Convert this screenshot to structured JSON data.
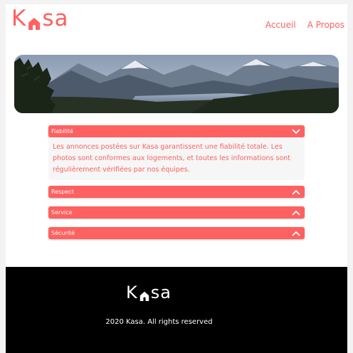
{
  "header": {
    "logo_before": "K",
    "logo_after": "sa",
    "nav": {
      "home": "Accueil",
      "about": "A Propos"
    }
  },
  "collapses": [
    {
      "title": "Fiabilité",
      "open": true,
      "content": "Les annonces postées sur Kasa garantissent une fiabilité totale. Les photos sont conformes aux logements, et toutes les informations sont régulièrement vérifiées par nos équipes."
    },
    {
      "title": "Respect",
      "open": false
    },
    {
      "title": "Service",
      "open": false
    },
    {
      "title": "Sécurité",
      "open": false
    }
  ],
  "footer": {
    "logo_before": "K",
    "logo_after": "sa",
    "copyright": "2020 Kasa. All rights reserved"
  },
  "colors": {
    "brand": "#ff6060",
    "footer_bg": "#000000",
    "body_bg": "#f6f6f6"
  },
  "icons": {
    "logo_house": "house-icon",
    "collapse_open": "chevron-down-icon",
    "collapse_closed": "chevron-up-icon"
  }
}
